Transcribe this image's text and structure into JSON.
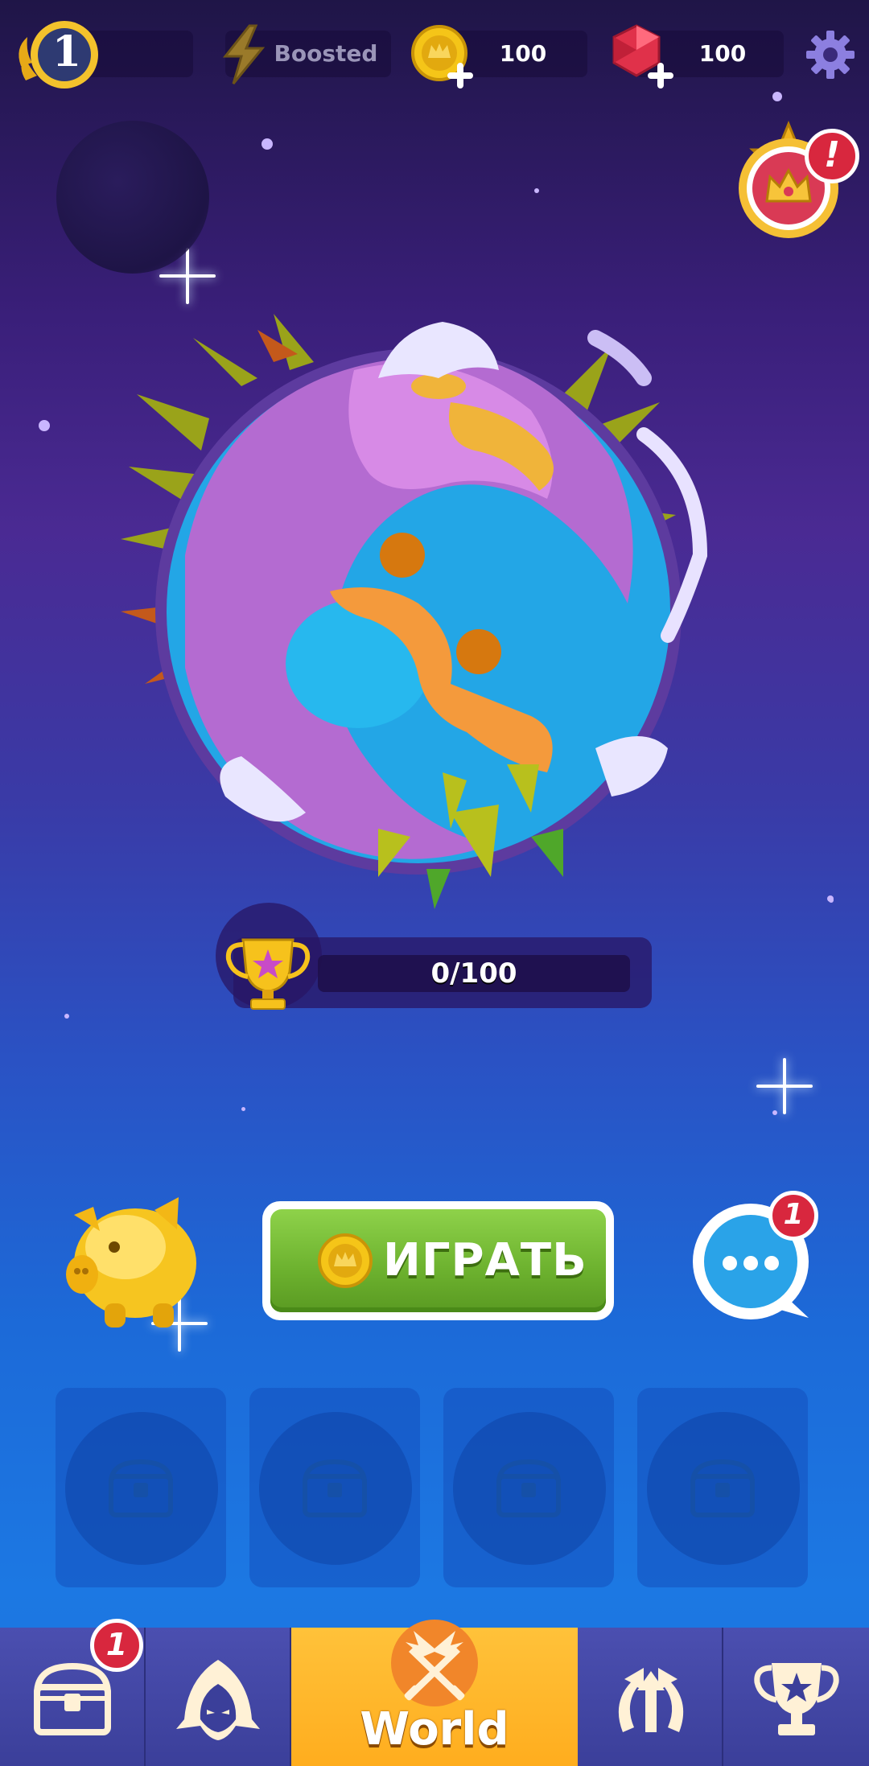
{
  "topbar": {
    "level": "1",
    "boost_label": "Boosted",
    "coins": "100",
    "gems": "100"
  },
  "quest_badge_mark": "!",
  "trophy": {
    "progress_text": "0/100",
    "current": 0,
    "target": 100
  },
  "play_button": {
    "label": "ИГРАТЬ"
  },
  "chat": {
    "badge_count": "1"
  },
  "chest_slots": [
    {
      "state": "empty"
    },
    {
      "state": "empty"
    },
    {
      "state": "empty"
    },
    {
      "state": "empty"
    }
  ],
  "bottom_nav": {
    "items": [
      {
        "name": "chests",
        "icon": "chest-icon",
        "badge": "1"
      },
      {
        "name": "heroes",
        "icon": "hooded-hero-icon"
      },
      {
        "name": "world",
        "icon": "crossed-swords-icon",
        "label": "World",
        "active": true
      },
      {
        "name": "upgrades",
        "icon": "upgrade-arrows-icon"
      },
      {
        "name": "leaderboard",
        "icon": "trophy-icon"
      }
    ]
  },
  "colors": {
    "play_green": "#6cb12e",
    "active_tab": "#ffad1e",
    "badge_red": "#d8273e",
    "coin_gold": "#f5c518",
    "gem_red": "#e0314a"
  }
}
